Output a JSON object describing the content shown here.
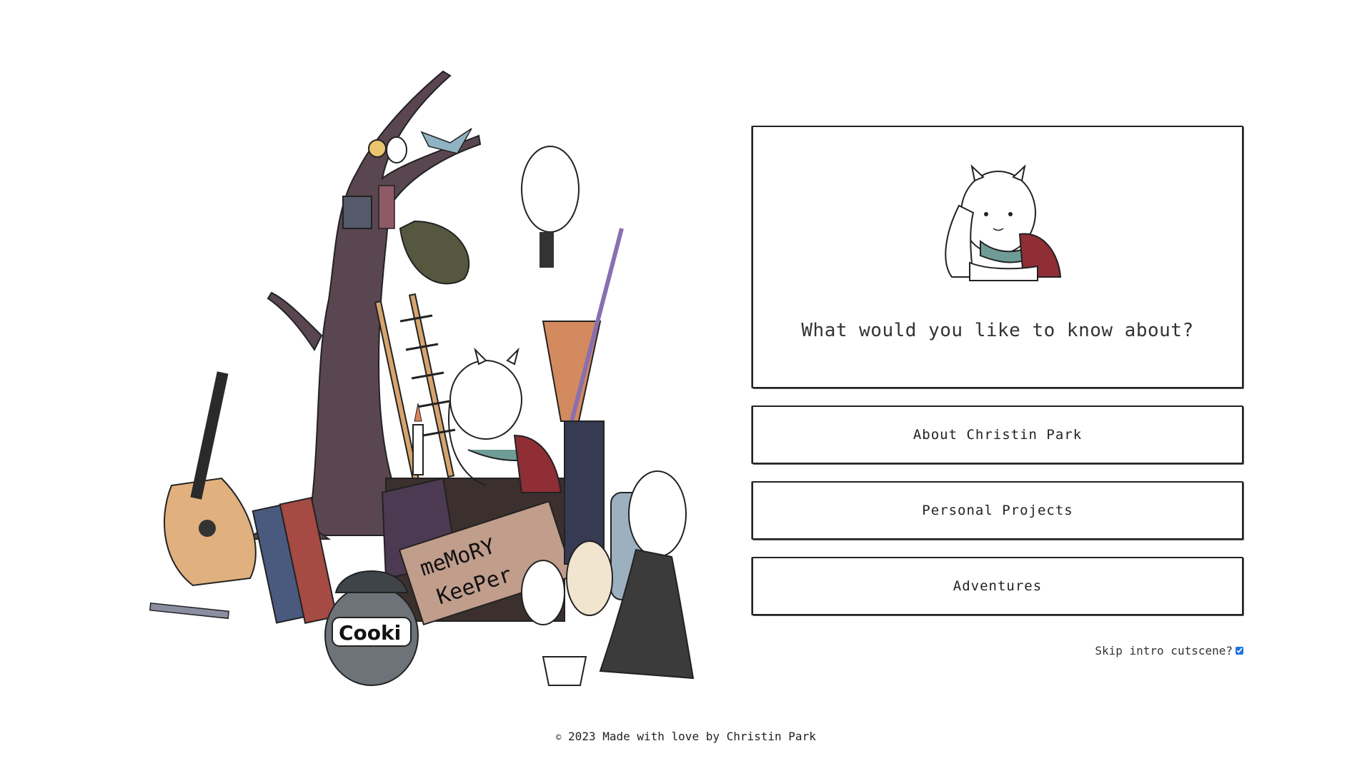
{
  "dialog": {
    "question": "What would you like to know about?"
  },
  "options": [
    {
      "label": "About Christin Park"
    },
    {
      "label": "Personal Projects"
    },
    {
      "label": "Adventures"
    }
  ],
  "skip": {
    "label": "Skip intro cutscene?",
    "checked": true
  },
  "footer": {
    "copyright_symbol": "©",
    "text": "2023 Made with love by Christin Park"
  },
  "illustration": {
    "sign_text_line1": "meMoRY",
    "sign_text_line2": "KeePer",
    "jar_label": "Cooki"
  },
  "colors": {
    "border": "#222222",
    "checkbox": "#1a73e8",
    "tree": "#5a4650",
    "scarf_teal": "#6f9c97",
    "scarf_red": "#8f2e35"
  }
}
